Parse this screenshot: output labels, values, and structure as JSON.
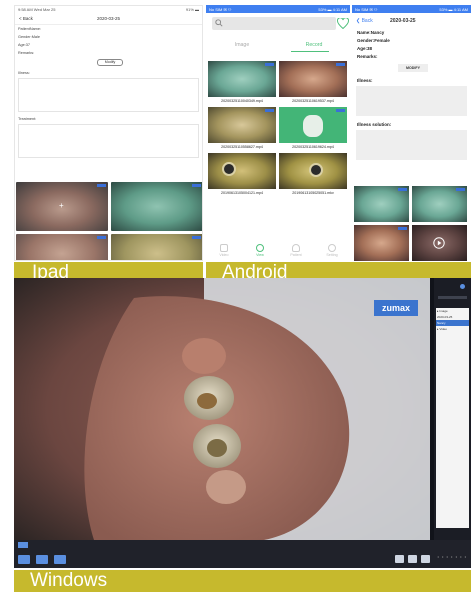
{
  "labels": {
    "ipad": "Ipad",
    "android": "Android",
    "windows": "Windows"
  },
  "ipad": {
    "status_left": "9:58 AM  Wed Mar 25",
    "status_right": "91% ▬",
    "back_label": "< Back",
    "date": "2020-03-25",
    "fields": [
      "PatientName:",
      "Gender:Male",
      "Age:37",
      "Remarks:"
    ],
    "modify_label": "Modify",
    "illness_label": "Illness:",
    "treatment_label": "Treatment:",
    "thumb_count": 4
  },
  "android": {
    "status_left": "No SIM ✉ ⚇",
    "status_right": "53% ▬ 4:11 AM",
    "tab_image": "Image",
    "tab_record": "Record",
    "videos": [
      "20200325110040349.mp4",
      "20200325110619537.mp4",
      "20200325110558627.mp4",
      "20200325110619624.mp4",
      "20190613105004121.mp4",
      "20190613105025051.mkv"
    ],
    "nav": [
      "Video",
      "View",
      "Patient",
      "Setting"
    ]
  },
  "android_detail": {
    "status_left": "No SIM ✉ ⚇",
    "status_right": "53% ▬ 4:11 AM",
    "back_label": "Back",
    "date": "2020-03-25",
    "fields": [
      "Name:Nancy",
      "Gender:Female",
      "Age:38",
      "Remarks:"
    ],
    "modify_label": "MODIFY",
    "illness_label": "Illness:",
    "solution_label": "Illness solution:"
  },
  "windows": {
    "brand": "zumax",
    "side_items": [
      "▸ Image",
      "  2020-03-25",
      "  Nancy",
      "▸ Video"
    ],
    "dots": "• • • • • • •"
  },
  "colors": {
    "label_bar": "#c6b92d",
    "android_blue": "#3f7ff0",
    "record_green": "#4fc07c",
    "brand_blue": "#3b74ce"
  }
}
